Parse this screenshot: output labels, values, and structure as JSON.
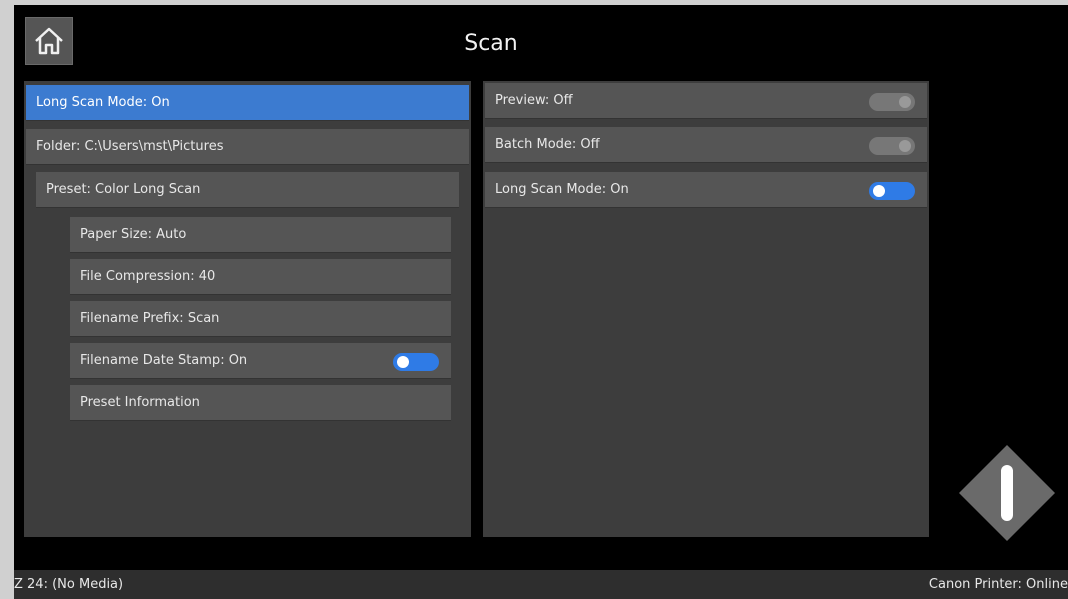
{
  "header": {
    "title": "Scan"
  },
  "left_panel": {
    "items": [
      {
        "label": "Long Scan Mode: On"
      },
      {
        "label": "Folder: C:\\Users\\mst\\Pictures"
      },
      {
        "label": "Preset: Color Long Scan"
      },
      {
        "label": "Paper Size: Auto"
      },
      {
        "label": "File Compression: 40"
      },
      {
        "label": "Filename Prefix: Scan"
      },
      {
        "label": "Filename Date Stamp: On"
      },
      {
        "label": "Preset Information"
      }
    ]
  },
  "right_panel": {
    "items": [
      {
        "label": "Preview: Off"
      },
      {
        "label": "Batch Mode: Off"
      },
      {
        "label": "Long Scan Mode: On"
      }
    ]
  },
  "status_bar": {
    "left": "Z 24: (No Media)",
    "right": "Canon Printer: Online"
  },
  "colors": {
    "accent": "#3c7bd0",
    "toggle_on": "#2f7be6",
    "panel": "#3d3d3d",
    "row": "#555555"
  },
  "icons": {
    "home": "home-icon",
    "scan": "scan-start-icon"
  }
}
